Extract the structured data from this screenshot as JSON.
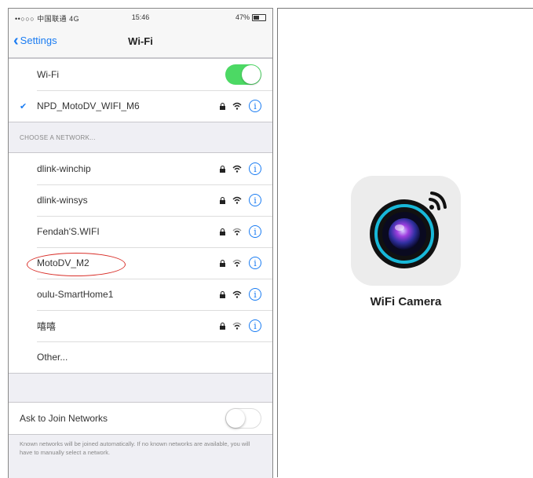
{
  "status_bar": {
    "carrier": "••○○○ 中国联通  4G",
    "time": "15:46",
    "battery": "47%"
  },
  "nav": {
    "back_label": "Settings",
    "title": "Wi-Fi"
  },
  "wifi_toggle": {
    "label": "Wi-Fi",
    "state": "on"
  },
  "connected_network": {
    "name": "NPD_MotoDV_WIFI_M6"
  },
  "section_header": "CHOOSE A NETWORK...",
  "networks": [
    {
      "name": "dlink-winchip"
    },
    {
      "name": "dlink-winsys"
    },
    {
      "name": "Fendah'S.WIFI"
    },
    {
      "name": "MotoDV_M2",
      "highlighted": true
    },
    {
      "name": "oulu-SmartHome1"
    },
    {
      "name": "嘻嘻"
    }
  ],
  "other_label": "Other...",
  "ask_to_join": {
    "label": "Ask to Join Networks",
    "state": "off"
  },
  "footer_text": "Known networks will be joined automatically. If no known networks are available, you will have to manually select a network.",
  "app": {
    "name": "WiFi Camera",
    "icon": "camera-lens-icon"
  },
  "colors": {
    "ios_blue": "#1a7cf2",
    "toggle_green": "#4cd964",
    "highlight_red": "#d9302a"
  }
}
